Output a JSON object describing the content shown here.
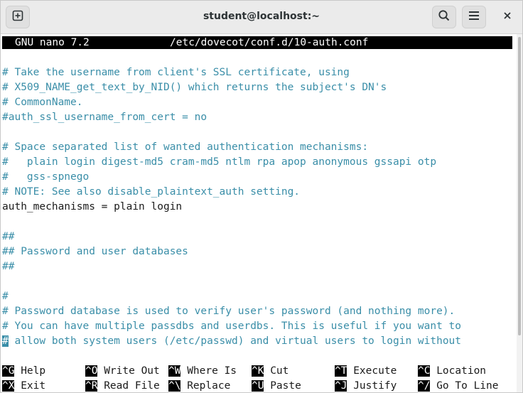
{
  "window": {
    "title": "student@localhost:~"
  },
  "titlebar": {
    "new_tab_icon": "plus-square-icon",
    "search_icon": "search-icon",
    "menu_icon": "hamburger-menu-icon",
    "close_icon": "close-icon"
  },
  "nano": {
    "version": "GNU nano 7.2",
    "filename": "/etc/dovecot/conf.d/10-auth.conf"
  },
  "colors": {
    "comment": "#3a8ea8",
    "text": "#1a1a1a",
    "header_bg": "#000000"
  },
  "lines": [
    {
      "text": "# Take the username from client's SSL certificate, using",
      "type": "comment"
    },
    {
      "text": "# X509_NAME_get_text_by_NID() which returns the subject's DN's",
      "type": "comment"
    },
    {
      "text": "# CommonName.",
      "type": "comment"
    },
    {
      "text": "#auth_ssl_username_from_cert = no",
      "type": "comment"
    },
    {
      "text": "",
      "type": "plain"
    },
    {
      "text": "# Space separated list of wanted authentication mechanisms:",
      "type": "comment"
    },
    {
      "text": "#   plain login digest-md5 cram-md5 ntlm rpa apop anonymous gssapi otp",
      "type": "comment"
    },
    {
      "text": "#   gss-spnego",
      "type": "comment"
    },
    {
      "text": "# NOTE: See also disable_plaintext_auth setting.",
      "type": "comment"
    },
    {
      "text": "auth_mechanisms = plain login",
      "type": "plain"
    },
    {
      "text": "",
      "type": "plain"
    },
    {
      "text": "##",
      "type": "comment"
    },
    {
      "text": "## Password and user databases",
      "type": "comment"
    },
    {
      "text": "##",
      "type": "comment"
    },
    {
      "text": "",
      "type": "plain"
    },
    {
      "text": "#",
      "type": "comment"
    },
    {
      "text": "# Password database is used to verify user's password (and nothing more).",
      "type": "comment"
    },
    {
      "text": "# You can have multiple passdbs and userdbs. This is useful if you want to",
      "type": "comment"
    },
    {
      "text": "# allow both system users (/etc/passwd) and virtual users to login without",
      "type": "comment",
      "cursor_at_start": true
    }
  ],
  "shortcuts_row1": [
    {
      "key": "^G",
      "label": "Help"
    },
    {
      "key": "^O",
      "label": "Write Out"
    },
    {
      "key": "^W",
      "label": "Where Is"
    },
    {
      "key": "^K",
      "label": "Cut"
    },
    {
      "key": "^T",
      "label": "Execute"
    },
    {
      "key": "^C",
      "label": "Location"
    }
  ],
  "shortcuts_row2": [
    {
      "key": "^X",
      "label": "Exit"
    },
    {
      "key": "^R",
      "label": "Read File"
    },
    {
      "key": "^\\",
      "label": "Replace"
    },
    {
      "key": "^U",
      "label": "Paste"
    },
    {
      "key": "^J",
      "label": "Justify"
    },
    {
      "key": "^/",
      "label": "Go To Line"
    }
  ]
}
